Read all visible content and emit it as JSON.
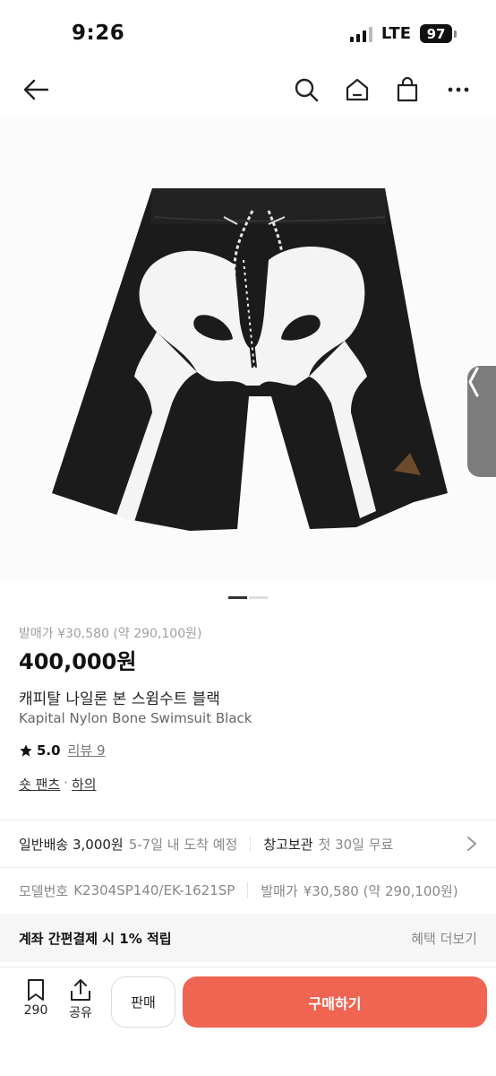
{
  "status_bar": {
    "time": "9:26",
    "network": "LTE",
    "battery": "97"
  },
  "nav": {
    "icons": [
      "arrow-left-icon",
      "search-icon",
      "home-icon",
      "shopping-bag-icon",
      "more-icon"
    ]
  },
  "gallery": {
    "slide_count": 2,
    "active_slide": 1
  },
  "product": {
    "reference_price": "발매가 ¥30,580 (약 290,100원)",
    "price": "400,000원",
    "title_ko": "캐피탈 나일론 본 스윔수트 블랙",
    "title_en": "Kapital Nylon Bone Swimsuit Black",
    "rating": "5.0",
    "reviews": "리뷰 9",
    "category_1": "숏 팬츠",
    "category_sep": "·",
    "category_2": "하의"
  },
  "shipping": {
    "label": "일반배송 3,000원",
    "eta": "5-7일 내 도착 예정",
    "storage_label": "창고보관",
    "storage_value": "첫 30일 무료"
  },
  "model": {
    "label": "모델번호",
    "value": "K2304SP140/EK-1621SP",
    "release_label": "발매가",
    "release_value": "¥30,580 (약 290,100원)"
  },
  "points": {
    "label": "계좌 간편결제 시 1% 적립",
    "more": "혜택 더보기"
  },
  "bottom": {
    "wish_count": "290",
    "share_label": "공유",
    "sell_label": "판매",
    "buy_label": "구매하기"
  },
  "colors": {
    "accent": "#ef6552",
    "text": "#111111",
    "muted": "#888888"
  }
}
